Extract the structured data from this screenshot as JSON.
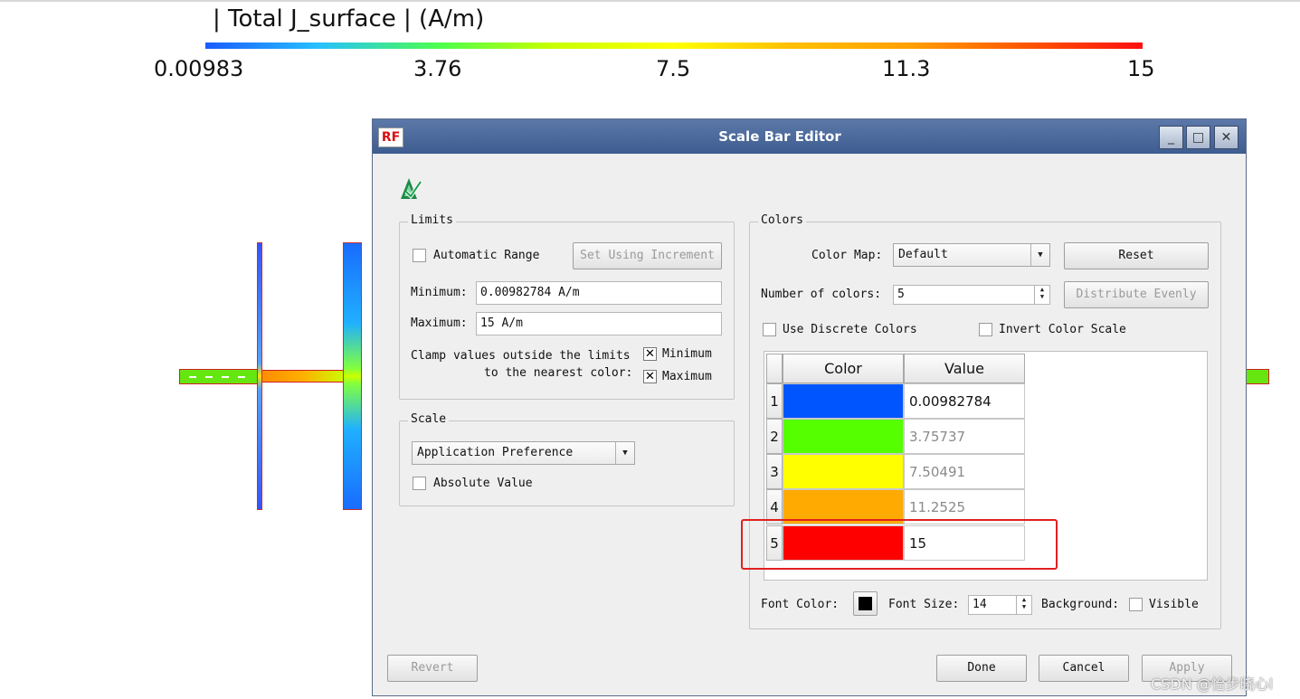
{
  "scale_bar": {
    "title": "| Total J_surface | (A/m)",
    "ticks": [
      "0.00983",
      "3.76",
      "7.5",
      "11.3",
      "15"
    ]
  },
  "dialog": {
    "title": "Scale Bar Editor",
    "logo": "RF",
    "window_buttons": {
      "minimize": "_",
      "maximize": "□",
      "close": "✕"
    },
    "limits": {
      "label": "Limits",
      "automatic_range_label": "Automatic Range",
      "automatic_range_checked": false,
      "set_using_increment_label": "Set Using Increment",
      "minimum_label": "Minimum:",
      "minimum_value": "0.00982784 A/m",
      "maximum_label": "Maximum:",
      "maximum_value": "15 A/m",
      "clamp_line1": "Clamp values outside the limits",
      "clamp_line2": "to the nearest color:",
      "clamp_minimum_label": "Minimum",
      "clamp_minimum_checked": true,
      "clamp_maximum_label": "Maximum",
      "clamp_maximum_checked": true
    },
    "scale": {
      "label": "Scale",
      "mode_value": "Application Preference",
      "absolute_value_label": "Absolute Value",
      "absolute_value_checked": false
    },
    "colors": {
      "label": "Colors",
      "color_map_label": "Color Map:",
      "color_map_value": "Default",
      "reset_label": "Reset",
      "number_of_colors_label": "Number of colors:",
      "number_of_colors_value": "5",
      "distribute_evenly_label": "Distribute Evenly",
      "use_discrete_label": "Use Discrete Colors",
      "use_discrete_checked": false,
      "invert_label": "Invert Color Scale",
      "invert_checked": false,
      "table": {
        "headers": [
          "Color",
          "Value"
        ],
        "rows": [
          {
            "index": "1",
            "color": "#0055ff",
            "value": "0.00982784",
            "editable": true
          },
          {
            "index": "2",
            "color": "#55ff00",
            "value": "3.75737",
            "editable": false
          },
          {
            "index": "3",
            "color": "#ffff00",
            "value": "7.50491",
            "editable": false
          },
          {
            "index": "4",
            "color": "#ffaa00",
            "value": "11.2525",
            "editable": false
          },
          {
            "index": "5",
            "color": "#ff0000",
            "value": "15",
            "editable": true
          }
        ]
      },
      "font_color_label": "Font Color:",
      "font_color": "#000000",
      "font_size_label": "Font Size:",
      "font_size_value": "14",
      "background_label": "Background:",
      "visible_label": "Visible",
      "visible_checked": false
    },
    "buttons": {
      "revert": "Revert",
      "done": "Done",
      "cancel": "Cancel",
      "apply": "Apply"
    }
  },
  "watermark": "CSDN @怡步晓心l",
  "colors": {
    "titlebar": "#4a6a9c",
    "dialog_bg": "#efefef",
    "highlight": "#e02020"
  }
}
